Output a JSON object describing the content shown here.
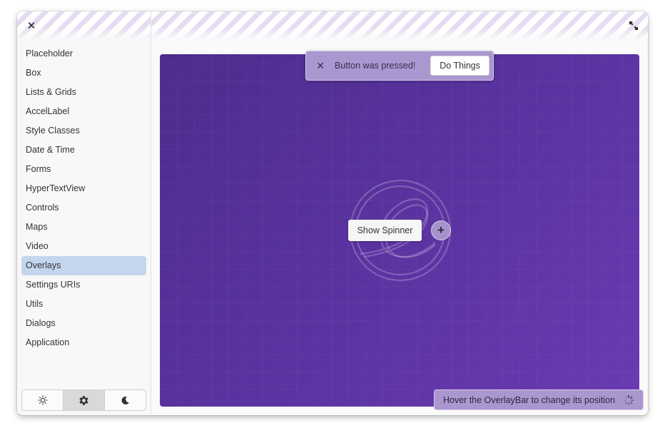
{
  "window": {
    "close_icon": "close-icon",
    "fullscreen_icon": "fullscreen-icon"
  },
  "sidebar": {
    "items": [
      {
        "label": "Placeholder"
      },
      {
        "label": "Box"
      },
      {
        "label": "Lists & Grids"
      },
      {
        "label": "AccelLabel"
      },
      {
        "label": "Style Classes"
      },
      {
        "label": "Date & Time"
      },
      {
        "label": "Forms"
      },
      {
        "label": "HyperTextView"
      },
      {
        "label": "Controls"
      },
      {
        "label": "Maps"
      },
      {
        "label": "Video"
      },
      {
        "label": "Overlays"
      },
      {
        "label": "Settings URIs"
      },
      {
        "label": "Utils"
      },
      {
        "label": "Dialogs"
      },
      {
        "label": "Application"
      }
    ],
    "active_item": "Overlays",
    "theme_switch": {
      "options": [
        "light",
        "system",
        "dark"
      ],
      "selected": "system"
    }
  },
  "main": {
    "toast": {
      "message": "Button was pressed!",
      "action_label": "Do Things"
    },
    "spinner_button_label": "Show Spinner",
    "add_button_icon": "plus-icon",
    "overlay_bar_label": "Hover the OverlayBar to change its position"
  },
  "colors": {
    "accent_selection": "#c3d6ee",
    "canvas_purple": "#5a33a0",
    "overlay_tint": "#aa97cf"
  }
}
